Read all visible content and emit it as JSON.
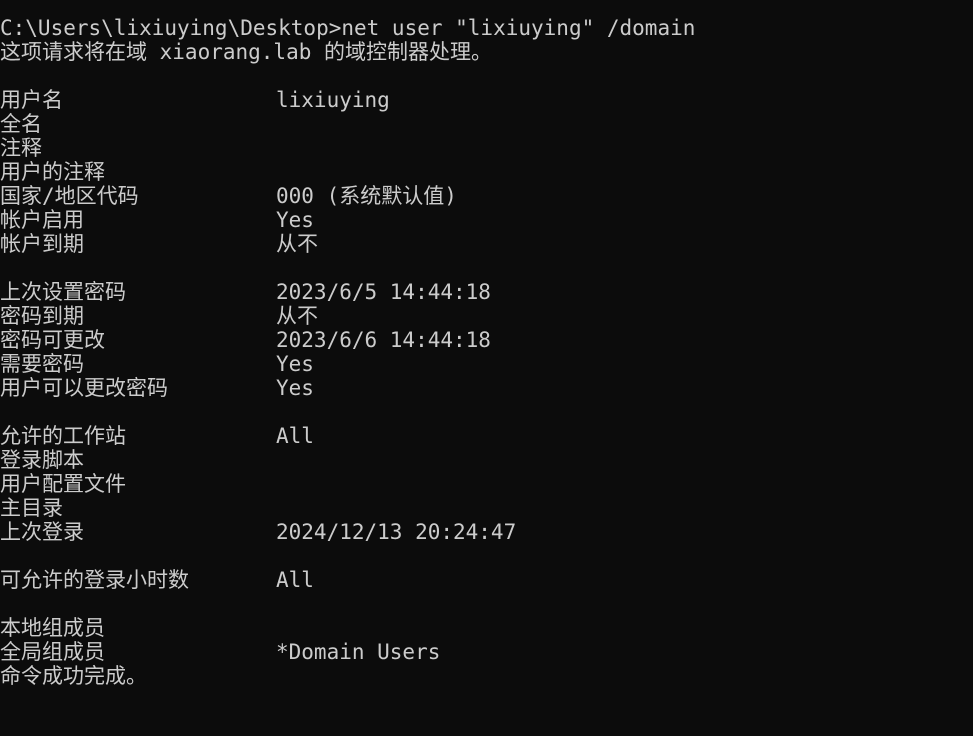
{
  "terminal": {
    "command_line": "C:\\Users\\lixiuying\\Desktop>net user \"lixiuying\" /domain",
    "processing_line": "这项请求将在域 xiaorang.lab 的域控制器处理。",
    "fields": {
      "user_name": {
        "label": "用户名",
        "value": "lixiuying"
      },
      "full_name": {
        "label": "全名",
        "value": ""
      },
      "comment": {
        "label": "注释",
        "value": ""
      },
      "user_comment": {
        "label": "用户的注释",
        "value": ""
      },
      "country_code": {
        "label": "国家/地区代码",
        "value": "000 (系统默认值)"
      },
      "account_active": {
        "label": "帐户启用",
        "value": "Yes"
      },
      "account_expires": {
        "label": "帐户到期",
        "value": "从不"
      },
      "password_last_set": {
        "label": "上次设置密码",
        "value": "2023/6/5 14:44:18"
      },
      "password_expires": {
        "label": "密码到期",
        "value": "从不"
      },
      "password_changeable": {
        "label": "密码可更改",
        "value": "2023/6/6 14:44:18"
      },
      "password_required": {
        "label": "需要密码",
        "value": "Yes"
      },
      "user_may_change_password": {
        "label": "用户可以更改密码",
        "value": "Yes"
      },
      "workstations_allowed": {
        "label": "允许的工作站",
        "value": "All"
      },
      "logon_script": {
        "label": "登录脚本",
        "value": ""
      },
      "user_profile": {
        "label": "用户配置文件",
        "value": ""
      },
      "home_directory": {
        "label": "主目录",
        "value": ""
      },
      "last_logon": {
        "label": "上次登录",
        "value": "2024/12/13 20:24:47"
      },
      "logon_hours_allowed": {
        "label": "可允许的登录小时数",
        "value": "All"
      },
      "local_group_memberships": {
        "label": "本地组成员",
        "value": ""
      },
      "global_group_memberships": {
        "label": "全局组成员",
        "value": "*Domain Users"
      }
    },
    "completion_line": "命令成功完成。"
  },
  "colors": {
    "background": "#0c0c0c",
    "foreground": "#cccccc"
  }
}
